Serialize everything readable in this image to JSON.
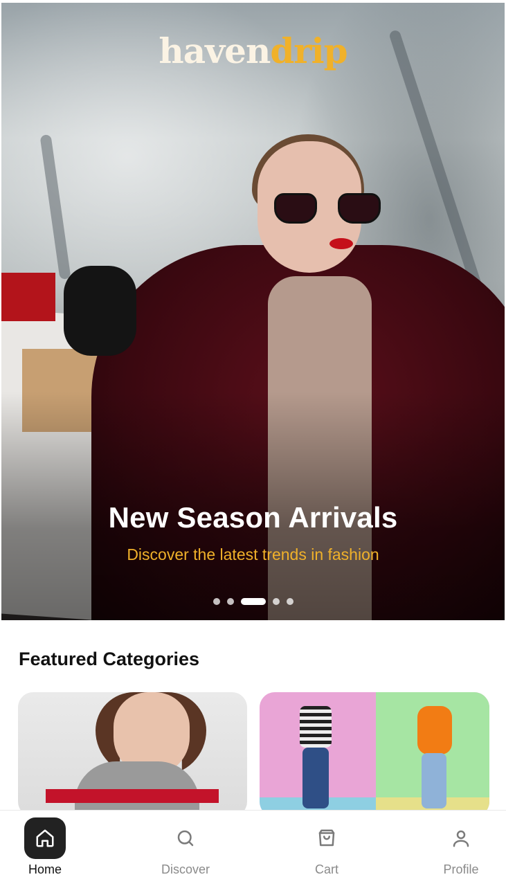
{
  "brand": {
    "part1": "haven",
    "part2": "drip",
    "color_primary": "#fbf3e4",
    "color_accent": "#f0b12a"
  },
  "hero": {
    "title": "New Season Arrivals",
    "subtitle": "Discover the latest trends in fashion",
    "dots_count": 5,
    "active_dot": 3
  },
  "featured": {
    "title": "Featured Categories"
  },
  "nav": {
    "items": [
      {
        "label": "Home",
        "icon": "home-icon",
        "active": true
      },
      {
        "label": "Discover",
        "icon": "search-icon",
        "active": false
      },
      {
        "label": "Cart",
        "icon": "shopping-bag-icon",
        "active": false
      },
      {
        "label": "Profile",
        "icon": "user-icon",
        "active": false
      }
    ]
  },
  "colors": {
    "accent": "#f0b12a",
    "nav_active_bg": "#222222",
    "nav_inactive": "#8a8a8a"
  }
}
